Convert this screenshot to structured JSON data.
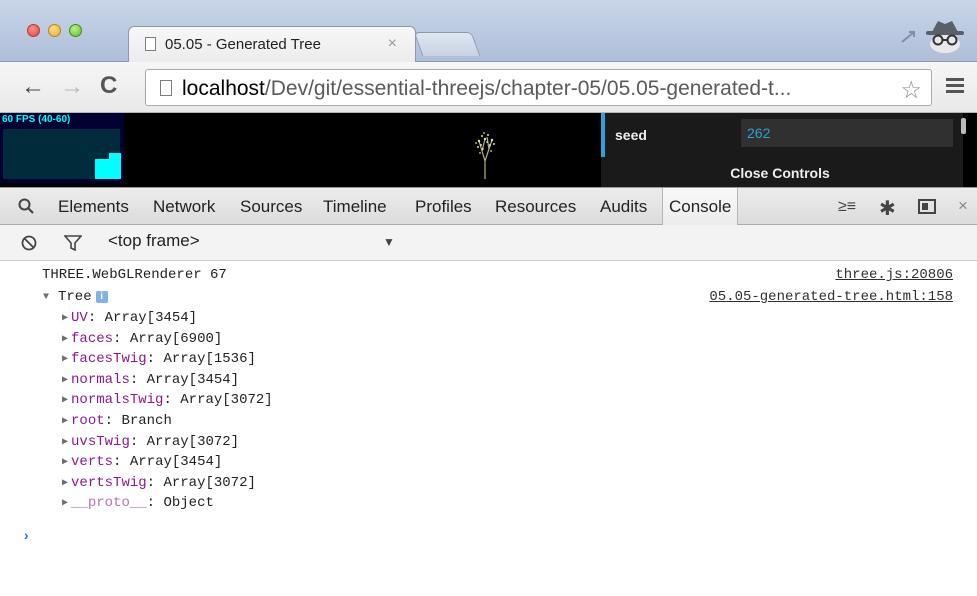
{
  "browser": {
    "tab_title": "05.05 - Generated Tree",
    "tab_close": "×",
    "url_host": "localhost",
    "url_path": "/Dev/git/essential-threejs/chapter-05/05.05-generated-t..."
  },
  "viewport": {
    "stats": {
      "label": "60 FPS (40-60)",
      "fps": 60,
      "min": 40,
      "max": 60
    },
    "gui": {
      "seed_label": "seed",
      "seed_value": "262",
      "close_label": "Close Controls"
    }
  },
  "devtools": {
    "tabs": [
      "Elements",
      "Network",
      "Sources",
      "Timeline",
      "Profiles",
      "Resources",
      "Audits",
      "Console"
    ],
    "active_tab": "Console",
    "frame_label": "<top frame>"
  },
  "console": {
    "log1_text": "THREE.WebGLRenderer 67",
    "log1_source": "three.js:20806",
    "log2_text": "Tree",
    "log2_source": "05.05-generated-tree.html:158",
    "info_badge": "i",
    "properties": [
      {
        "key": "UV",
        "value": "Array[3454]"
      },
      {
        "key": "faces",
        "value": "Array[6900]"
      },
      {
        "key": "facesTwig",
        "value": "Array[1536]"
      },
      {
        "key": "normals",
        "value": "Array[3454]"
      },
      {
        "key": "normalsTwig",
        "value": "Array[3072]"
      },
      {
        "key": "root",
        "value": "Branch"
      },
      {
        "key": "uvsTwig",
        "value": "Array[3072]"
      },
      {
        "key": "verts",
        "value": "Array[3454]"
      },
      {
        "key": "vertsTwig",
        "value": "Array[3072]"
      },
      {
        "key": "__proto__",
        "value": "Object"
      }
    ],
    "prompt": "›"
  },
  "colors": {
    "gui_accent": "#2fa1d6",
    "stats_fg": "#00ffff",
    "stats_bg": "#000033",
    "console_key": "#8b1a89",
    "console_prompt": "#2c6fd6"
  }
}
